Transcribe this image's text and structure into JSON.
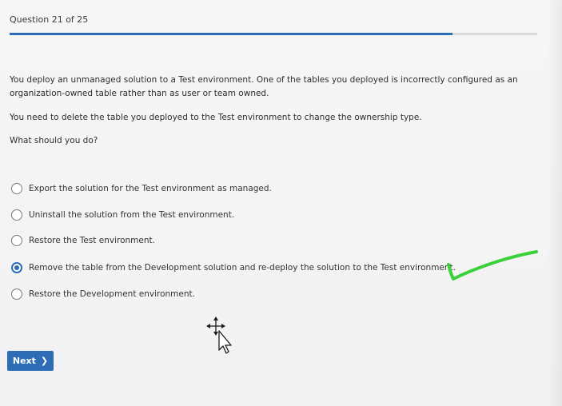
{
  "header": {
    "counter": "Question 21 of 25",
    "progress_fraction": 0.84
  },
  "question": {
    "text": "You deploy an unmanaged solution to a Test environment. One of the tables you deployed is incorrectly configured as an organization-owned table rather than as user or team owned.",
    "requirement": "You need to delete the table you deployed to the Test environment to change the ownership type.",
    "prompt": "What should you do?"
  },
  "options": [
    {
      "label": "Export the solution for the Test environment as managed.",
      "selected": false
    },
    {
      "label": "Uninstall the solution from the Test environment.",
      "selected": false
    },
    {
      "label": "Restore the Test environment.",
      "selected": false
    },
    {
      "label": "Remove the table from the Development solution and re-deploy the solution to the Test environment.",
      "selected": true
    },
    {
      "label": "Restore the Development environment.",
      "selected": false
    }
  ],
  "navigation": {
    "next_label": "Next"
  },
  "annotations": {
    "checkmark_color": "#3ad13a",
    "cursor_icon": "move-cursor-icon"
  },
  "colors": {
    "accent": "#2d6db5"
  }
}
